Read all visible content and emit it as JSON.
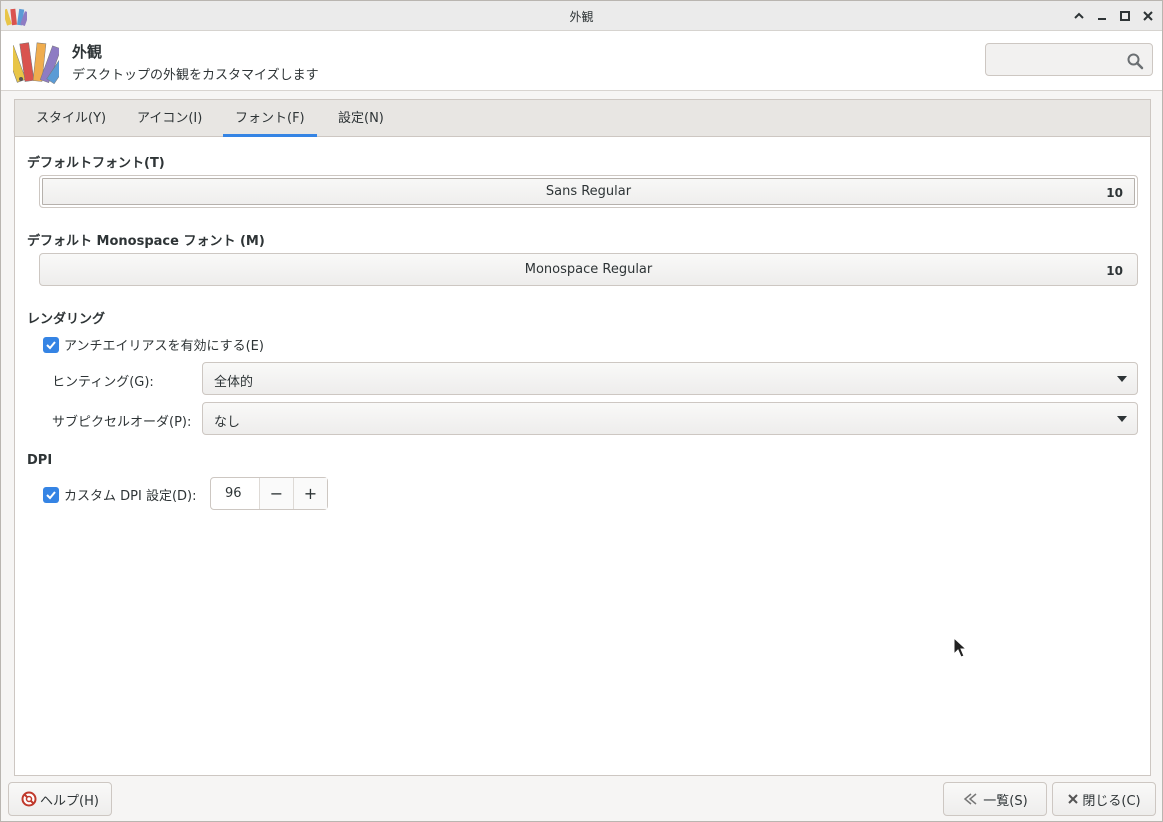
{
  "window": {
    "title": "外観"
  },
  "header": {
    "title": "外観",
    "subtitle": "デスクトップの外観をカスタマイズします",
    "search_placeholder": ""
  },
  "tabs": [
    {
      "label": "スタイル(Y)",
      "active": false
    },
    {
      "label": "アイコン(I)",
      "active": false
    },
    {
      "label": "フォント(F)",
      "active": true
    },
    {
      "label": "設定(N)",
      "active": false
    }
  ],
  "fonts": {
    "default_label": "デフォルトフォント(T)",
    "default_font": "Sans Regular",
    "default_size": "10",
    "mono_label": "デフォルト Monospace フォント (M)",
    "mono_font": "Monospace Regular",
    "mono_size": "10"
  },
  "rendering": {
    "label": "レンダリング",
    "antialias_label": "アンチエイリアスを有効にする(E)",
    "antialias_checked": true,
    "hinting_label": "ヒンティング(G):",
    "hinting_value": "全体的",
    "subpixel_label": "サブピクセルオーダ(P):",
    "subpixel_value": "なし"
  },
  "dpi": {
    "label": "DPI",
    "custom_label": "カスタム DPI 設定(D):",
    "custom_checked": true,
    "value": "96",
    "minus": "−",
    "plus": "+"
  },
  "footer": {
    "help_label": "ヘルプ(H)",
    "overview_label": "一覧(S)",
    "close_label": "閉じる(C)"
  },
  "colors": {
    "accent": "#3584e4"
  }
}
